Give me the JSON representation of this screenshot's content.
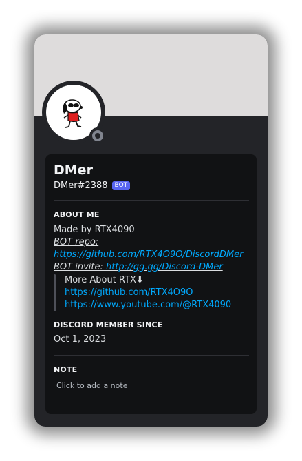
{
  "profile": {
    "display_name": "DMer",
    "username": "DMer#2388",
    "badge": "BOT",
    "status_color": "#80848e",
    "banner_color": "#dedcdc"
  },
  "about": {
    "title": "ABOUT ME",
    "made_by": "Made by RTX4090",
    "repo_label": "BOT repo:",
    "repo_url": "https://github.com/RTX4O9O/DiscordDMer",
    "invite_label": "BOT invite:",
    "invite_url": "http://gg.gg/Discord-DMer",
    "quote_title": "More About RTX⬇",
    "quote_link1": "https://github.com/RTX4O9O",
    "quote_link2": "https://www.youtube.com/@RTX4090"
  },
  "member_since": {
    "title": "DISCORD MEMBER SINCE",
    "date": "Oct 1, 2023"
  },
  "note": {
    "title": "NOTE",
    "placeholder": "Click to add a note"
  }
}
